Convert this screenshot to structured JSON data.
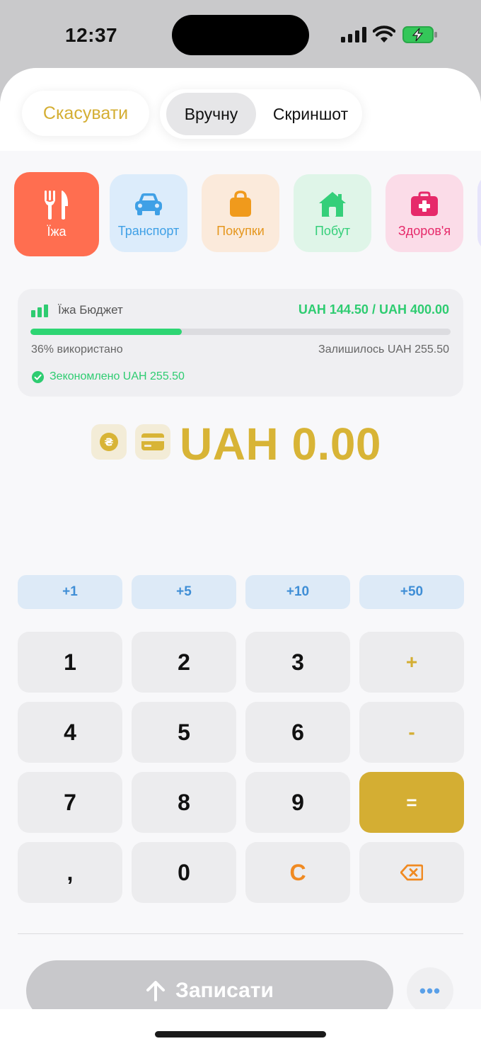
{
  "status": {
    "time": "12:37"
  },
  "header": {
    "cancel": "Скасувати",
    "tabs": [
      {
        "label": "Вручну",
        "selected": true
      },
      {
        "label": "Скриншот",
        "selected": false
      }
    ]
  },
  "categories": [
    {
      "label": "Їжа",
      "icon": "fork-knife-icon",
      "color": "#ff6e50",
      "active": true
    },
    {
      "label": "Транспорт",
      "icon": "car-icon",
      "color": "#3fa0e6"
    },
    {
      "label": "Покупки",
      "icon": "shopping-bag-icon",
      "color": "#f09a1c"
    },
    {
      "label": "Побут",
      "icon": "house-icon",
      "color": "#35cf7a"
    },
    {
      "label": "Здоров'я",
      "icon": "medkit-icon",
      "color": "#e62a6a"
    }
  ],
  "budget": {
    "title": "Їжа Бюджет",
    "amount": "UAH 144.50 / UAH 400.00",
    "progress": 0.36,
    "used": "36% використано",
    "remaining": "Залишилось UAH 255.50",
    "saved": "Зекономлено UAH 255.50"
  },
  "amount": {
    "display": "UAH 0.00",
    "currency_symbol": "₴"
  },
  "quick_add": [
    "+1",
    "+5",
    "+10",
    "+50"
  ],
  "keypad": {
    "rows": [
      [
        "1",
        "2",
        "3",
        "+"
      ],
      [
        "4",
        "5",
        "6",
        "-"
      ],
      [
        "7",
        "8",
        "9",
        "="
      ],
      [
        ",",
        "0",
        "C",
        "backspace-icon"
      ]
    ]
  },
  "footer": {
    "record": "Записати",
    "more": "•••"
  }
}
